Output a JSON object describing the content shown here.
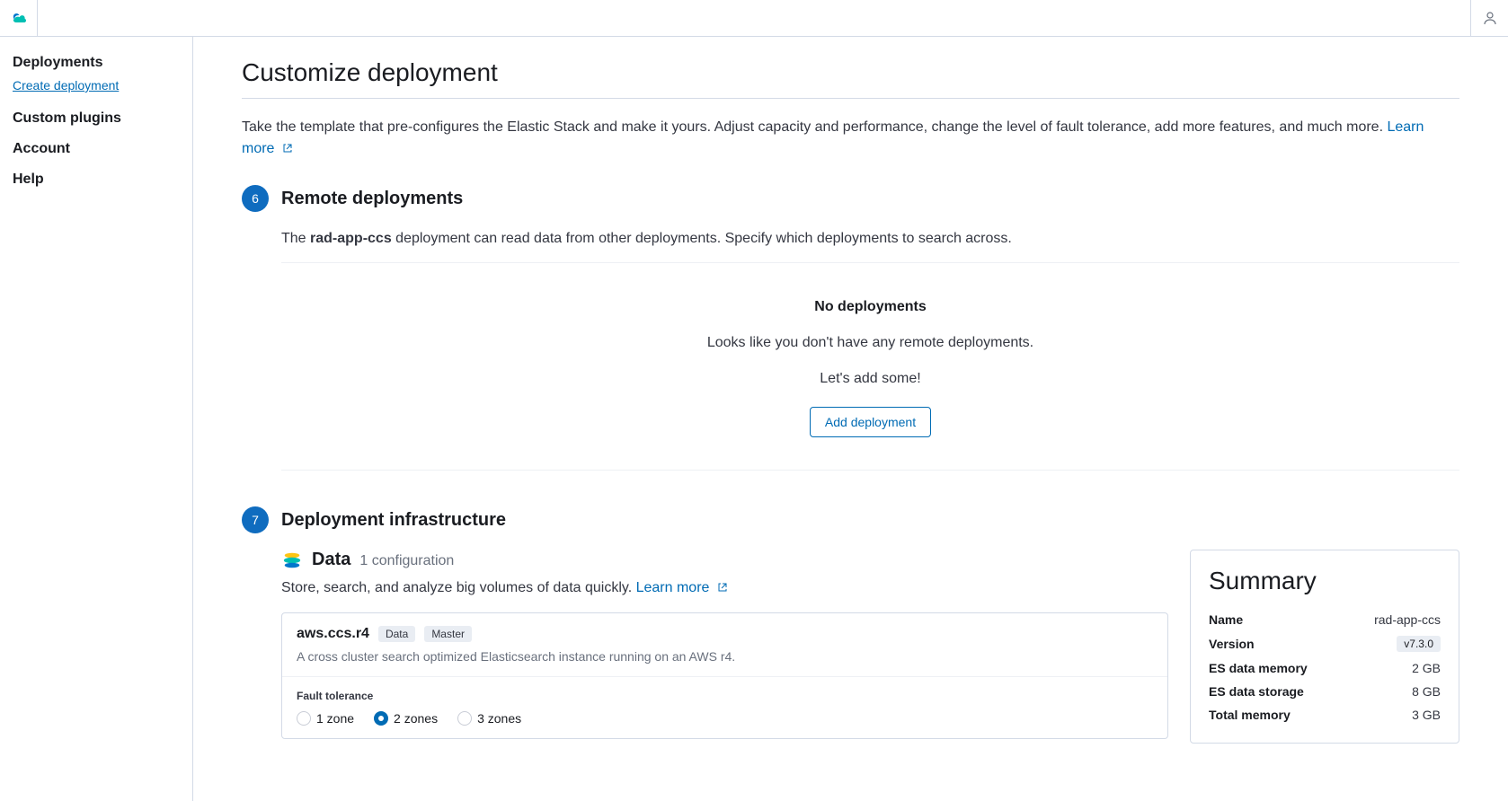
{
  "sidebar": {
    "deployments": "Deployments",
    "create": "Create deployment",
    "plugins": "Custom plugins",
    "account": "Account",
    "help": "Help"
  },
  "page": {
    "title": "Customize deployment",
    "desc_prefix": "Take the template that pre-configures the Elastic Stack and make it yours. Adjust capacity and performance, change the level of fault tolerance, add more features, and much more. ",
    "learn_more": "Learn more"
  },
  "step6": {
    "num": "6",
    "title": "Remote deployments",
    "desc_prefix": "The ",
    "deployment_name": "rad-app-ccs",
    "desc_suffix": " deployment can read data from other deployments. Specify which deployments to search across.",
    "empty_title": "No deployments",
    "empty_line1": "Looks like you don't have any remote deployments.",
    "empty_line2": "Let's add some!",
    "add_btn": "Add deployment"
  },
  "step7": {
    "num": "7",
    "title": "Deployment infrastructure",
    "data_label": "Data",
    "data_count": "1 configuration",
    "data_desc_prefix": "Store, search, and analyze big volumes of data quickly. ",
    "learn_more": "Learn more",
    "instance": {
      "name": "aws.ccs.r4",
      "badge1": "Data",
      "badge2": "Master",
      "desc": "A cross cluster search optimized Elasticsearch instance running on an AWS r4.",
      "ft_label": "Fault tolerance",
      "zones": [
        "1 zone",
        "2 zones",
        "3 zones"
      ],
      "selected": 1
    }
  },
  "summary": {
    "title": "Summary",
    "rows": [
      {
        "label": "Name",
        "value": "rad-app-ccs",
        "type": "text"
      },
      {
        "label": "Version",
        "value": "v7.3.0",
        "type": "badge"
      },
      {
        "label": "ES data memory",
        "value": "2 GB",
        "type": "text"
      },
      {
        "label": "ES data storage",
        "value": "8 GB",
        "type": "text"
      },
      {
        "label": "Total memory",
        "value": "3 GB",
        "type": "text"
      }
    ]
  }
}
